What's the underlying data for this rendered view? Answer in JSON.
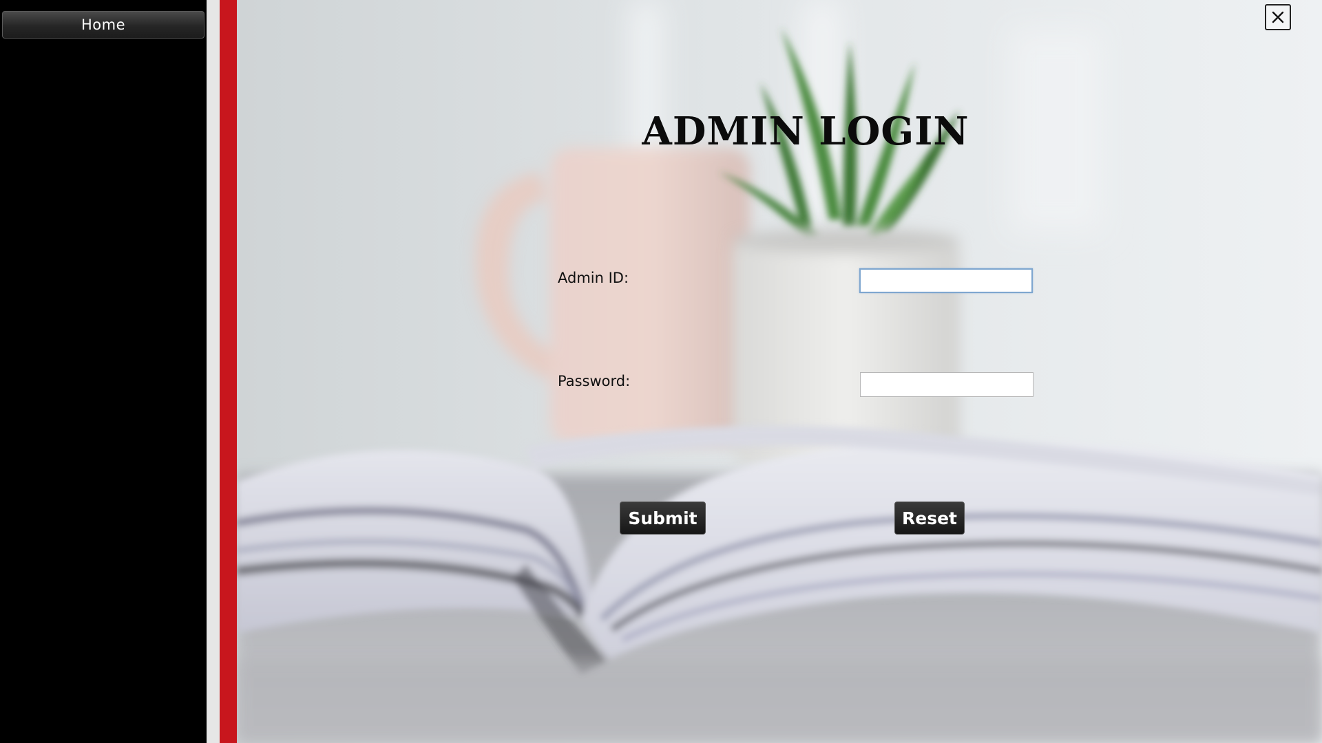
{
  "sidebar": {
    "home_label": "Home"
  },
  "window": {
    "close_icon": "close-icon"
  },
  "login": {
    "title": "ADMIN LOGIN",
    "admin_id_label": "Admin ID:",
    "admin_id_value": "",
    "password_label": "Password:",
    "password_value": "",
    "submit_label": "Submit",
    "reset_label": "Reset"
  },
  "colors": {
    "sidebar_bg": "#000000",
    "accent_red": "#c8161d",
    "divider_light": "#e6e6e6",
    "button_dark": "#1c1c1c"
  }
}
